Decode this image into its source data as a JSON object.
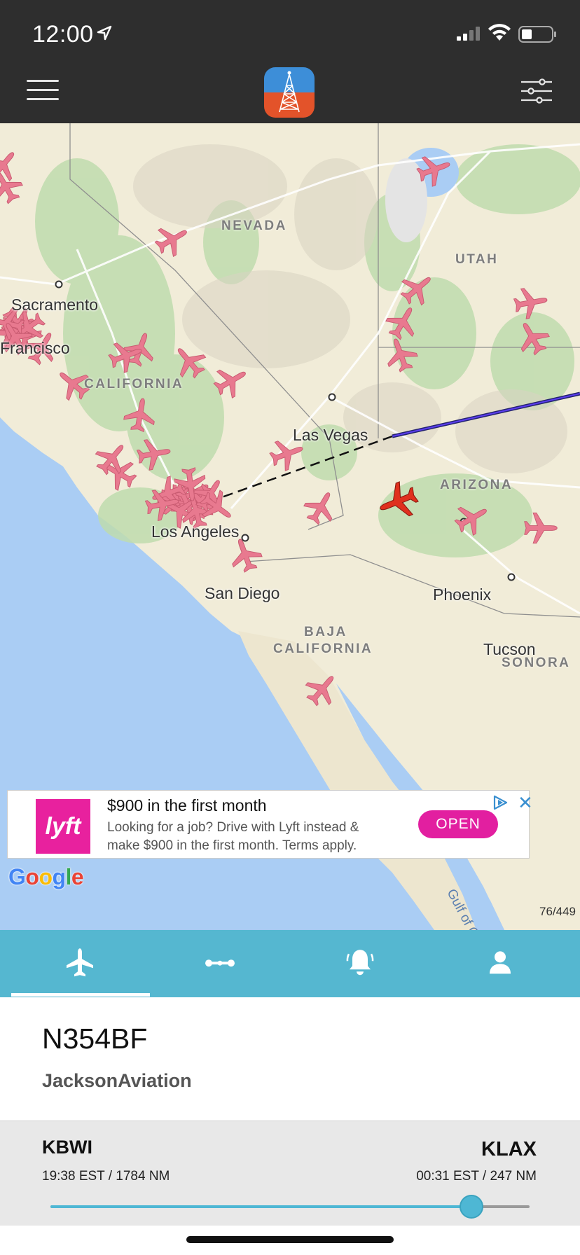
{
  "status_bar": {
    "time": "12:00"
  },
  "header": {
    "menu_icon": "hamburger-icon",
    "logo_icon": "radio-tower-icon",
    "filter_icon": "sliders-icon"
  },
  "map": {
    "cities": [
      {
        "key": "sacramento",
        "name": "Sacramento"
      },
      {
        "key": "san-francisco",
        "name": "Francisco"
      },
      {
        "key": "las-vegas",
        "name": "Las Vegas"
      },
      {
        "key": "los-angeles",
        "name": "Los Angeles"
      },
      {
        "key": "san-diego",
        "name": "San Diego"
      },
      {
        "key": "phoenix",
        "name": "Phoenix"
      },
      {
        "key": "tucson",
        "name": "Tucson"
      }
    ],
    "regions": {
      "nevada": "NEVADA",
      "utah": "UTAH",
      "california": "CALIFORNIA",
      "arizona": "ARIZONA",
      "baja_1": "BAJA",
      "baja_2": "CALIFORNIA",
      "sonora": "SONORA"
    },
    "gulf_label": "Gulf of Califo",
    "attribution": "Google",
    "aircraft_count": "76/449"
  },
  "ad": {
    "logo_text": "lyft",
    "title": "$900 in the first month",
    "body": "Looking for a job? Drive with Lyft instead & make $900 in the first month. Terms apply.",
    "cta": "OPEN"
  },
  "tabs": [
    {
      "name": "flights",
      "icon": "airplane-icon",
      "active": true
    },
    {
      "name": "routes",
      "icon": "route-icon",
      "active": false
    },
    {
      "name": "alerts",
      "icon": "bell-icon",
      "active": false
    },
    {
      "name": "profile",
      "icon": "person-icon",
      "active": false
    }
  ],
  "flight": {
    "tail_number": "N354BF",
    "operator": "JacksonAviation",
    "origin": {
      "code": "KBWI",
      "info": "19:38 EST / 1784 NM"
    },
    "destination": {
      "code": "KLAX",
      "info": "00:31 EST / 247 NM"
    },
    "progress": 0.878
  },
  "colors": {
    "header": "#2e2e2e",
    "tabbar": "#55b7d0",
    "accent": "#4eb7d4",
    "plane": "#e8798f",
    "selected_plane": "#e0301e"
  }
}
